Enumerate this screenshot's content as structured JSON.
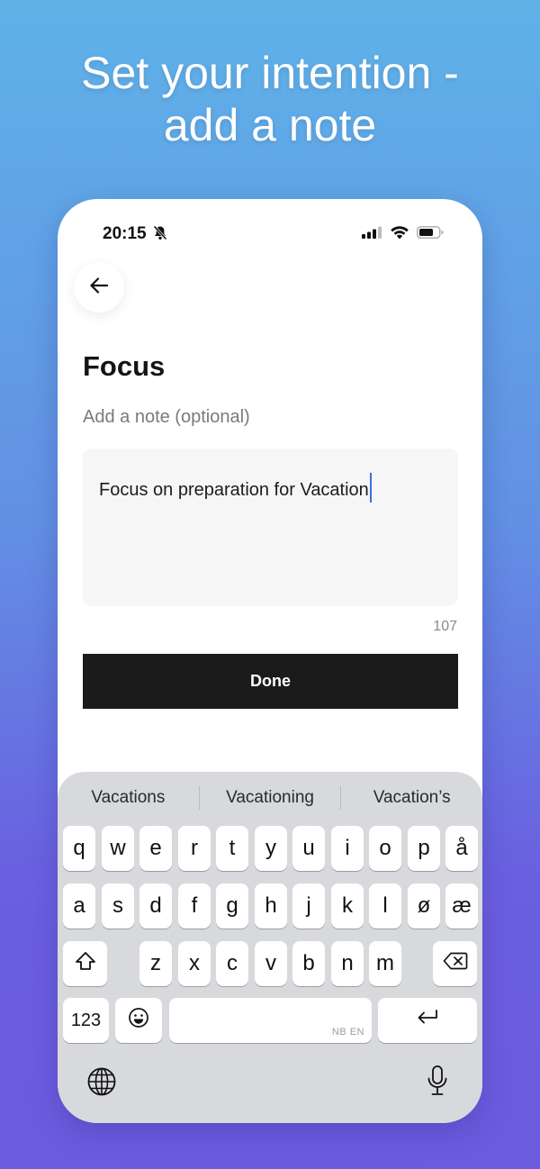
{
  "headline": {
    "line1": "Set your intention -",
    "line2": "add a note"
  },
  "statusbar": {
    "time": "20:15"
  },
  "screen": {
    "title": "Focus",
    "subtitle": "Add a note (optional)",
    "note_value": "Focus on preparation for Vacation",
    "char_count": "107",
    "done_label": "Done"
  },
  "keyboard": {
    "suggestions": [
      "Vacations",
      "Vacationing",
      "Vacation’s"
    ],
    "row1": [
      "q",
      "w",
      "e",
      "r",
      "t",
      "y",
      "u",
      "i",
      "o",
      "p",
      "å"
    ],
    "row2": [
      "a",
      "s",
      "d",
      "f",
      "g",
      "h",
      "j",
      "k",
      "l",
      "ø",
      "æ"
    ],
    "row3": [
      "z",
      "x",
      "c",
      "v",
      "b",
      "n",
      "m"
    ],
    "numbers_label": "123",
    "space_lang": "NB EN"
  },
  "colors": {
    "accent_caret": "#3a6ee8",
    "button_bg": "#1b1b1b"
  }
}
